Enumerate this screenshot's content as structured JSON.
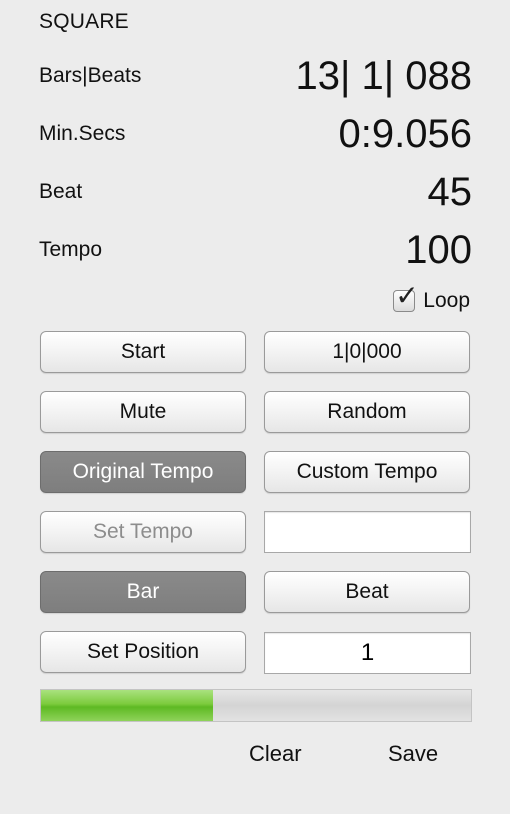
{
  "title": "SQUARE",
  "readouts": {
    "bars_beats": {
      "label": "Bars|Beats",
      "value": "13| 1| 088"
    },
    "min_secs": {
      "label": "Min.Secs",
      "value": "0:9.056"
    },
    "beat": {
      "label": "Beat",
      "value": "45"
    },
    "tempo": {
      "label": "Tempo",
      "value": "100"
    }
  },
  "loop": {
    "label": "Loop",
    "checked": true
  },
  "buttons": {
    "start": "Start",
    "position_reset": "1|0|000",
    "mute": "Mute",
    "random": "Random",
    "original_tempo": "Original Tempo",
    "custom_tempo": "Custom Tempo",
    "set_tempo": "Set Tempo",
    "bar": "Bar",
    "beat": "Beat",
    "set_position": "Set Position"
  },
  "fields": {
    "tempo_value": "",
    "position_value": "1"
  },
  "progress": {
    "fraction": 0.4,
    "color": "#6cc22e"
  },
  "footer": {
    "clear": "Clear",
    "save": "Save"
  }
}
